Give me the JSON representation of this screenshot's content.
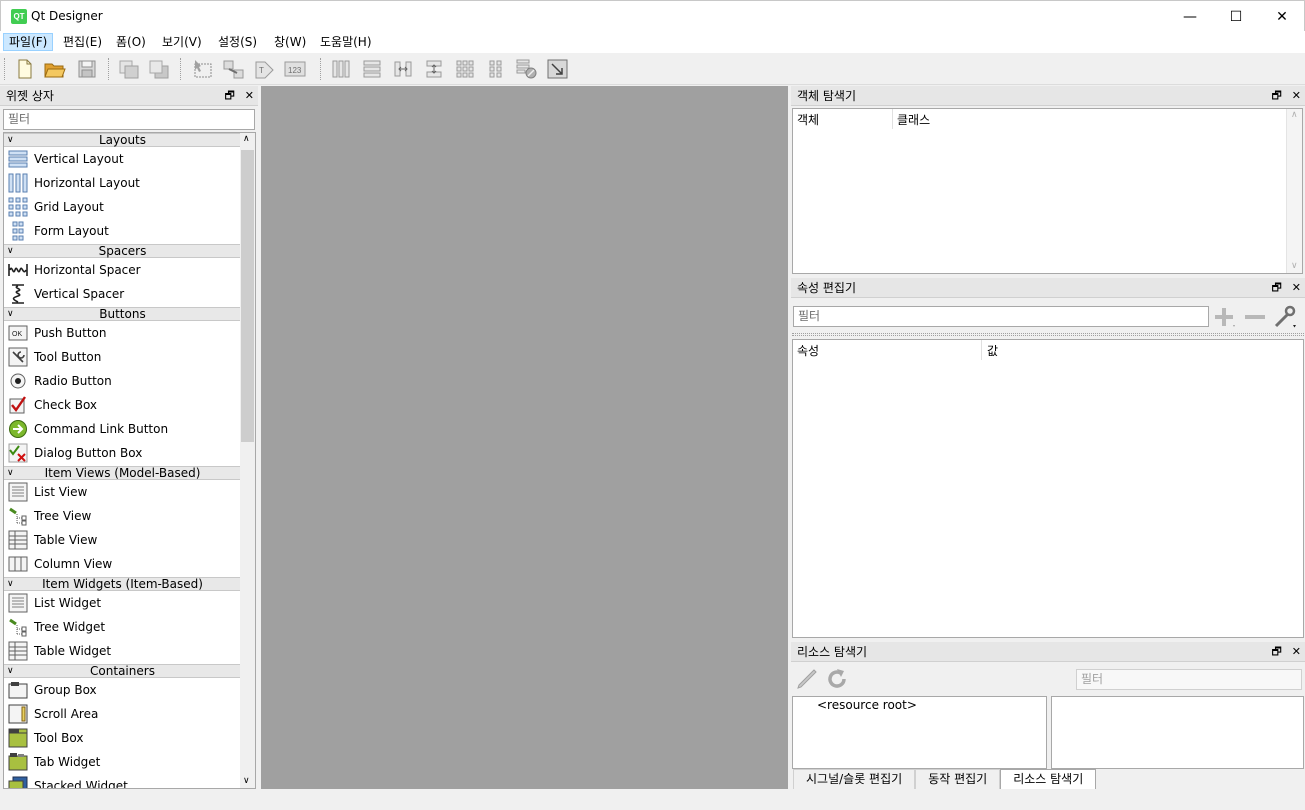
{
  "window": {
    "title": "Qt Designer",
    "app_icon_text": "QT",
    "minimize": "—",
    "maximize": "☐",
    "close": "✕"
  },
  "menu": [
    {
      "label": "파일(F)"
    },
    {
      "label": "편집(E)"
    },
    {
      "label": "폼(O)"
    },
    {
      "label": "보기(V)"
    },
    {
      "label": "설정(S)"
    },
    {
      "label": "창(W)"
    },
    {
      "label": "도움말(H)"
    }
  ],
  "widget_box": {
    "title": "위젯 상자",
    "filter_placeholder": "필터",
    "categories": [
      {
        "name": "Layouts",
        "items": [
          "Vertical Layout",
          "Horizontal Layout",
          "Grid Layout",
          "Form Layout"
        ]
      },
      {
        "name": "Spacers",
        "items": [
          "Horizontal Spacer",
          "Vertical Spacer"
        ]
      },
      {
        "name": "Buttons",
        "items": [
          "Push Button",
          "Tool Button",
          "Radio Button",
          "Check Box",
          "Command Link Button",
          "Dialog Button Box"
        ]
      },
      {
        "name": "Item Views (Model-Based)",
        "items": [
          "List View",
          "Tree View",
          "Table View",
          "Column View"
        ]
      },
      {
        "name": "Item Widgets (Item-Based)",
        "items": [
          "List Widget",
          "Tree Widget",
          "Table Widget"
        ]
      },
      {
        "name": "Containers",
        "items": [
          "Group Box",
          "Scroll Area",
          "Tool Box",
          "Tab Widget",
          "Stacked Widget"
        ]
      }
    ]
  },
  "object_inspector": {
    "title": "객체 탐색기",
    "col_object": "객체",
    "col_class": "클래스"
  },
  "property_editor": {
    "title": "속성 편집기",
    "filter_placeholder": "필터",
    "col_property": "속성",
    "col_value": "값"
  },
  "resource_browser": {
    "title": "리소스 탐색기",
    "filter_placeholder": "필터",
    "tree_root": "<resource root>"
  },
  "bottom_tabs": [
    {
      "label": "시그널/슬롯 편집기"
    },
    {
      "label": "동작 편집기"
    },
    {
      "label": "리소스 탐색기"
    }
  ]
}
